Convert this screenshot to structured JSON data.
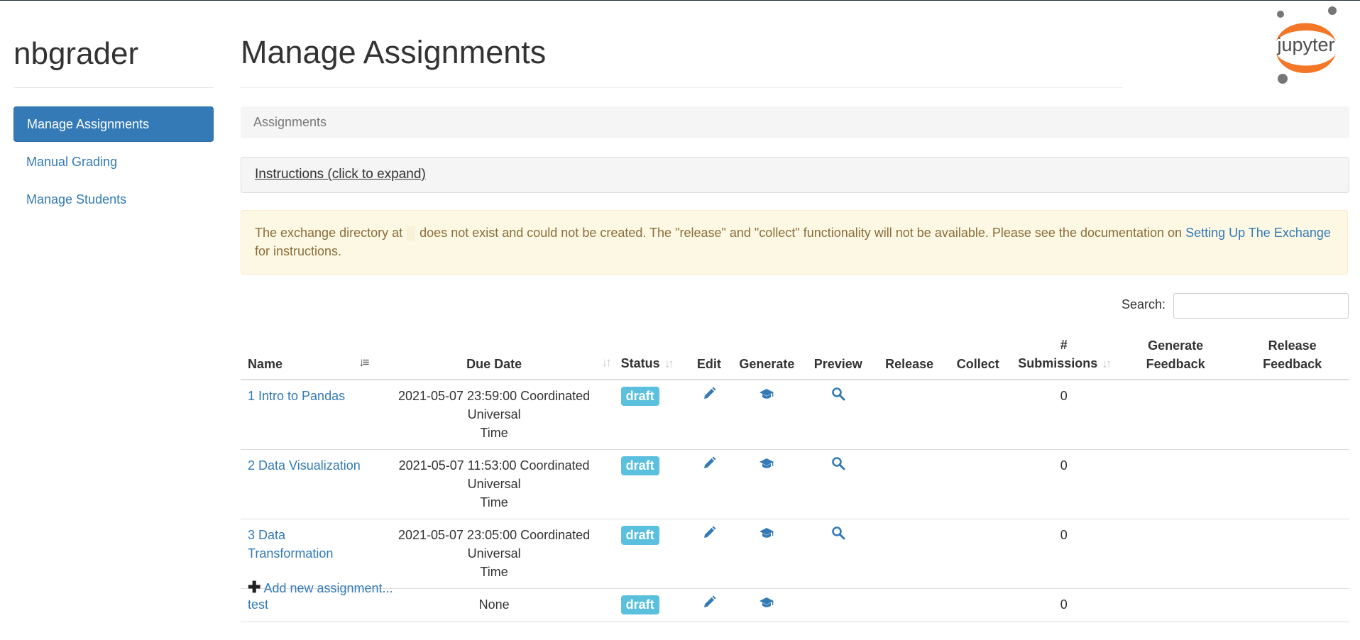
{
  "app": {
    "brand": "nbgrader",
    "logo_text": "jupyter"
  },
  "sidebar": {
    "items": [
      {
        "label": "Manage Assignments",
        "active": true
      },
      {
        "label": "Manual Grading",
        "active": false
      },
      {
        "label": "Manage Students",
        "active": false
      }
    ]
  },
  "page": {
    "title": "Manage Assignments",
    "breadcrumb": "Assignments",
    "instructions_link": "Instructions (click to expand)"
  },
  "alert": {
    "text_before": "The exchange directory at",
    "text_after": "does not exist and could not be created. The \"release\" and \"collect\" functionality will not be available. Please see the documentation on",
    "link": "Setting Up The Exchange",
    "text_end": "for instructions."
  },
  "search": {
    "label": "Search:",
    "value": ""
  },
  "table": {
    "headers": {
      "name": "Name",
      "due_date": "Due Date",
      "status": "Status",
      "edit": "Edit",
      "generate": "Generate",
      "preview": "Preview",
      "release": "Release",
      "collect": "Collect",
      "submissions_line1": "#",
      "submissions_line2": "Submissions",
      "gen_feedback_line1": "Generate",
      "gen_feedback_line2": "Feedback",
      "rel_feedback_line1": "Release",
      "rel_feedback_line2": "Feedback"
    },
    "rows": [
      {
        "name": "1 Intro to Pandas",
        "due_line1": "2021-05-07 23:59:00 Coordinated Universal",
        "due_line2": "Time",
        "status": "draft",
        "submissions": "0"
      },
      {
        "name": "2 Data Visualization",
        "due_line1": "2021-05-07 11:53:00 Coordinated Universal",
        "due_line2": "Time",
        "status": "draft",
        "submissions": "0"
      },
      {
        "name": "3 Data Transformation",
        "due_line1": "2021-05-07 23:05:00 Coordinated Universal",
        "due_line2": "Time",
        "status": "draft",
        "submissions": "0"
      },
      {
        "name": "test",
        "due_line1": "None",
        "due_line2": "",
        "status": "draft",
        "submissions": "0"
      }
    ]
  },
  "add_assignment": "Add new assignment...",
  "colors": {
    "primary": "#337ab7",
    "info": "#5bc0de",
    "warning_bg": "#fcf8e3",
    "warning_text": "#8a6d3b",
    "jupyter_orange": "#f37726"
  },
  "icons": {
    "edit": "pencil-icon",
    "generate": "graduation-cap-icon",
    "preview": "search-icon",
    "add": "plus-icon"
  }
}
